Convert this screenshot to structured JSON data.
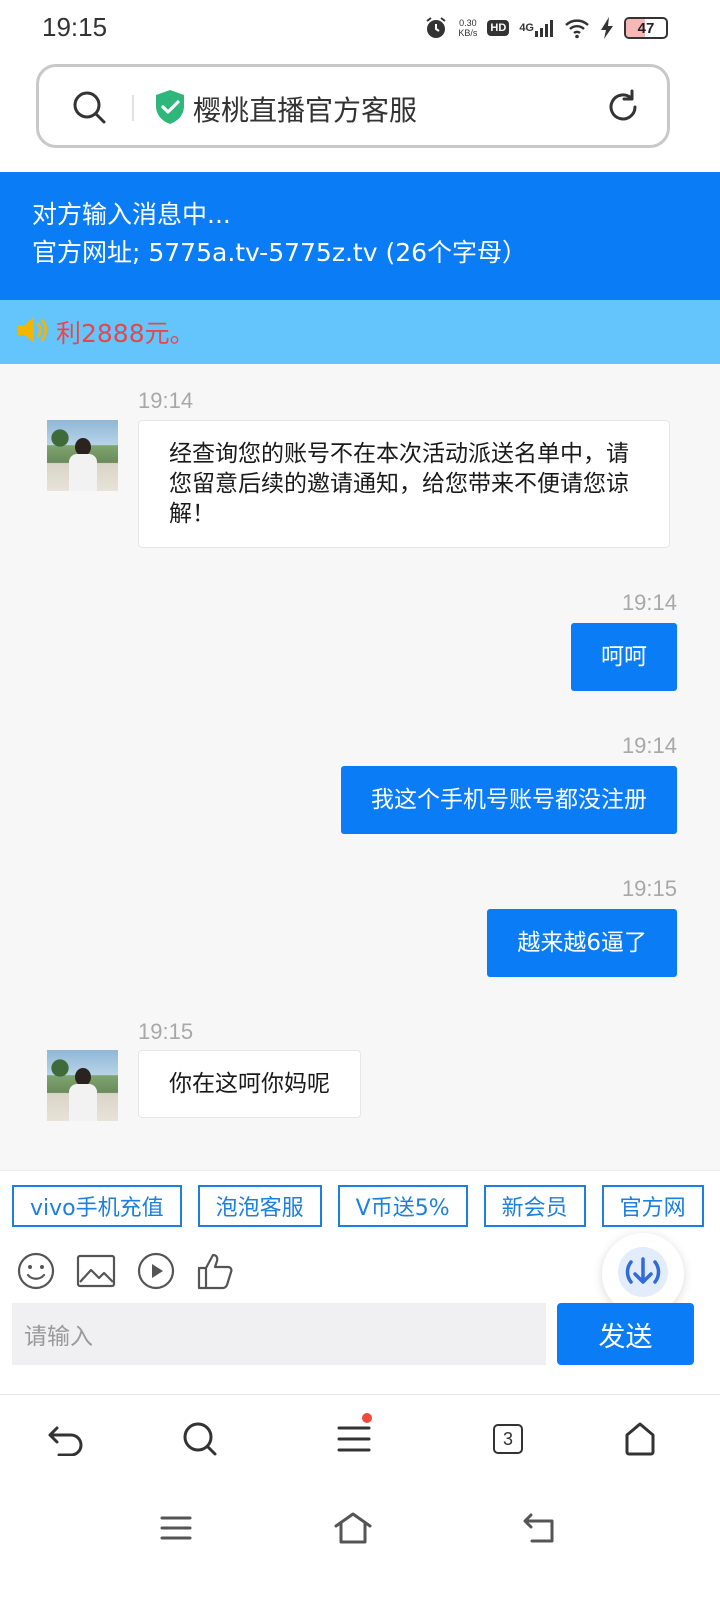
{
  "status_bar": {
    "time": "19:15",
    "speed_value": "0.30",
    "speed_unit": "KB/s",
    "hd": "HD",
    "network": "4G",
    "battery": "47",
    "battery_level_percent": 47
  },
  "address_bar": {
    "title": "樱桃直播官方客服"
  },
  "chat_header": {
    "line1": "对方输入消息中...",
    "line2": "官方网址; 5775a.tv-5775z.tv (26个字母）"
  },
  "marquee": {
    "text": "利2888元。"
  },
  "messages": [
    {
      "time": "19:14",
      "side": "in",
      "text": "经查询您的账号不在本次活动派送名单中，请您留意后续的邀请通知，给您带来不便请您谅解！"
    },
    {
      "time": "19:14",
      "side": "out",
      "text": "呵呵"
    },
    {
      "time": "19:14",
      "side": "out",
      "text": "我这个手机号账号都没注册"
    },
    {
      "time": "19:15",
      "side": "out",
      "text": "越来越6逼了"
    },
    {
      "time": "19:15",
      "side": "in",
      "text": "你在这呵你妈呢"
    }
  ],
  "quick_tags": [
    "vivo手机充值",
    "泡泡客服",
    "V币送5%",
    "新会员",
    "官方网"
  ],
  "input": {
    "placeholder": "请输入",
    "send_label": "发送"
  },
  "browser_nav": {
    "tab_count": "3"
  },
  "colors": {
    "primary": "#0a7df6",
    "marquee_bg": "#63c5fb",
    "marquee_text": "#e8464a",
    "shield": "#2fb67a"
  },
  "icons": [
    "search-icon",
    "shield-check-icon",
    "reload-icon",
    "speaker-icon",
    "emoji-icon",
    "image-icon",
    "video-icon",
    "thumbs-up-icon",
    "download-icon",
    "back-icon",
    "menu-icon",
    "tabs-icon",
    "home-icon"
  ]
}
